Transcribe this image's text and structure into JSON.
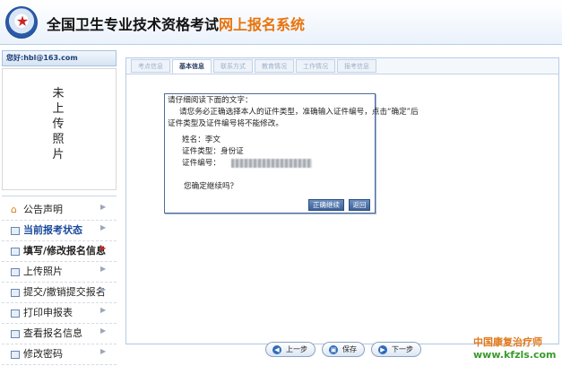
{
  "header": {
    "title_main": "全国卫生专业技术资格考试",
    "title_highlight": "网上报名系统"
  },
  "sidebar": {
    "greeting": "您好:hbl@163.com",
    "photo_placeholder": "未上传照片",
    "menu": [
      {
        "label": "公告声明",
        "icon": "home-icon"
      },
      {
        "label": "当前报考状态",
        "icon": "doc-icon"
      },
      {
        "label": "填写/修改报名信息",
        "icon": "doc-icon"
      },
      {
        "label": "上传照片",
        "icon": "doc-icon"
      },
      {
        "label": "提交/撤销提交报名",
        "icon": "doc-icon"
      },
      {
        "label": "打印申报表",
        "icon": "doc-icon"
      },
      {
        "label": "查看报名信息",
        "icon": "doc-icon"
      },
      {
        "label": "修改密码",
        "icon": "doc-icon"
      }
    ]
  },
  "tabs": [
    {
      "label": "考点信息"
    },
    {
      "label": "基本信息"
    },
    {
      "label": "联系方式"
    },
    {
      "label": "教育情况"
    },
    {
      "label": "工作情况"
    },
    {
      "label": "报考信息"
    }
  ],
  "dialog": {
    "line1": "请仔细阅读下面的文字：",
    "line2": "请您务必正确选择本人的证件类型，准确输入证件编号，点击“确定”后",
    "line3": "证件类型及证件编号将不能修改。",
    "name_label": "姓名：李文",
    "id_type_label": "证件类型：身份证",
    "id_number_label": "证件编号：",
    "id_number_value": "",
    "confirm_question": "您确定继续吗？",
    "confirm_button": "正确继续",
    "back_button": "返回"
  },
  "footer": {
    "prev_label": "上一步",
    "save_label": "保存",
    "next_label": "下一步"
  },
  "watermark": {
    "line1": "中国康复治疗师",
    "line2": "www.kfzls.com"
  }
}
